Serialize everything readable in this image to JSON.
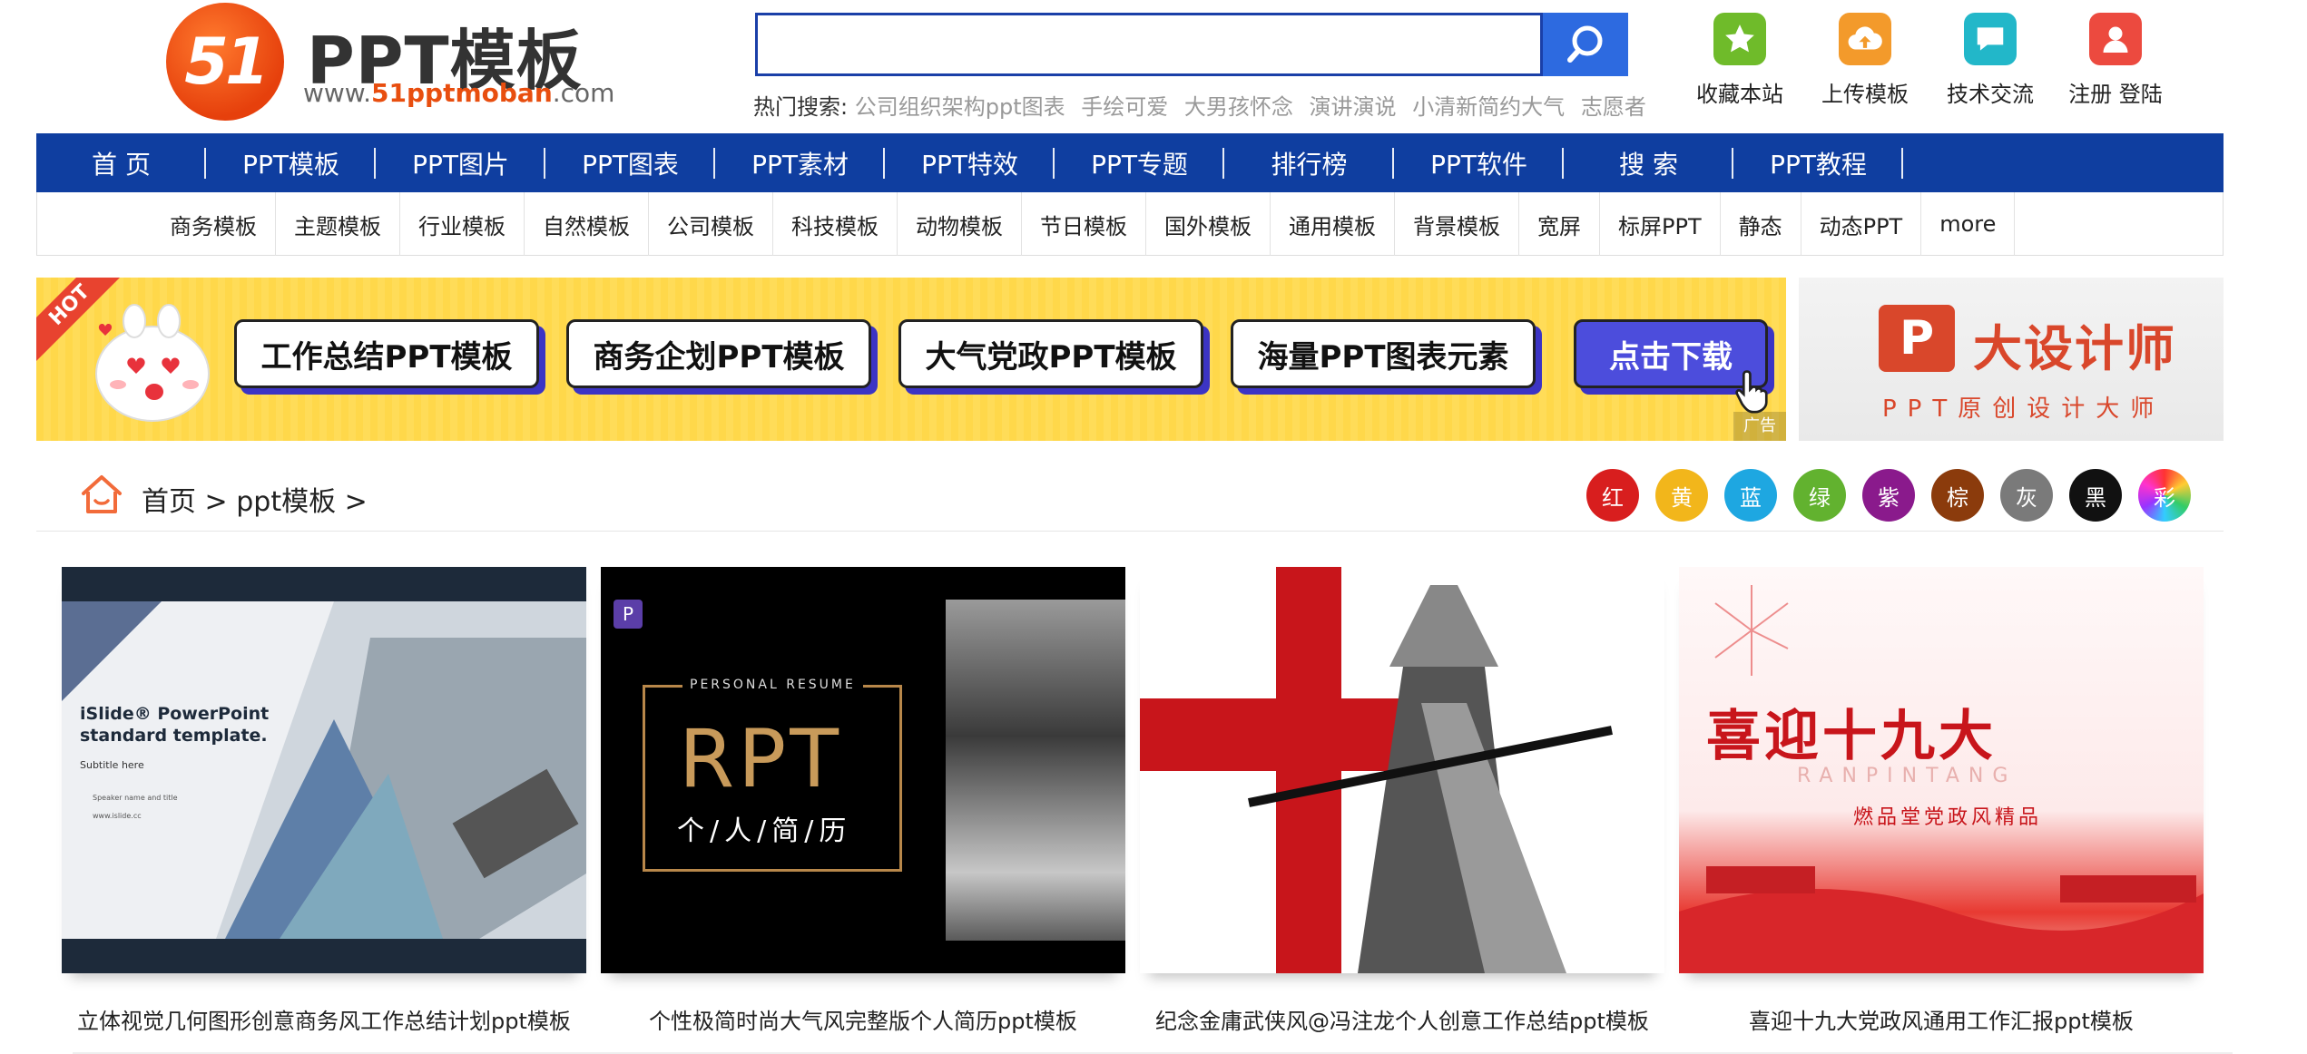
{
  "logo": {
    "badge": "51",
    "title": "PPT模板",
    "url_prefix": "www.",
    "url_brand": "51pptmoban",
    "url_suffix": ".com"
  },
  "search": {
    "value": "",
    "placeholder": ""
  },
  "hot_search": {
    "label": "热门搜索:",
    "keywords": [
      "公司组织架构ppt图表",
      "手绘可爱",
      "大男孩怀念",
      "演讲演说",
      "小清新简约大气",
      "志愿者"
    ]
  },
  "actions": [
    {
      "label": "收藏本站",
      "icon": "star-icon",
      "color": "#6fbb2a"
    },
    {
      "label": "上传模板",
      "icon": "upload-cloud-icon",
      "color": "#f39a2b"
    },
    {
      "label": "技术交流",
      "icon": "chat-icon",
      "color": "#22b7c9"
    },
    {
      "label": "注册 登陆",
      "icon": "user-icon",
      "color": "#ec4a3f"
    }
  ],
  "main_nav": [
    "首 页",
    "PPT模板",
    "PPT图片",
    "PPT图表",
    "PPT素材",
    "PPT特效",
    "PPT专题",
    "排行榜",
    "PPT软件",
    "搜 索",
    "PPT教程"
  ],
  "sub_nav": [
    "商务模板",
    "主题模板",
    "行业模板",
    "自然模板",
    "公司模板",
    "科技模板",
    "动物模板",
    "节日模板",
    "国外模板",
    "通用模板",
    "背景模板",
    "宽屏",
    "标屏PPT",
    "静态",
    "动态PPT",
    "more"
  ],
  "banner": {
    "hot": "HOT",
    "pills": [
      "工作总结PPT模板",
      "商务企划PPT模板",
      "大气党政PPT模板",
      "海量PPT图表元素"
    ],
    "cta": "点击下载",
    "ad_tag": "广告"
  },
  "banner2": {
    "logo": "P",
    "title": "大设计师",
    "subtitle": "PPT原创设计大师"
  },
  "breadcrumb": {
    "home": "首页",
    "sep1": ">",
    "section": "ppt模板",
    "sep2": ">"
  },
  "color_filters": [
    {
      "label": "红",
      "color": "#d81e1e"
    },
    {
      "label": "黄",
      "color": "#f2b61b"
    },
    {
      "label": "蓝",
      "color": "#1ea7e1"
    },
    {
      "label": "绿",
      "color": "#62b22f"
    },
    {
      "label": "紫",
      "color": "#8a1a8c"
    },
    {
      "label": "棕",
      "color": "#8b3b0c"
    },
    {
      "label": "灰",
      "color": "#7a7a7a"
    },
    {
      "label": "黑",
      "color": "#111111"
    },
    {
      "label": "彩",
      "color": "#e34d8b"
    }
  ],
  "cards": [
    {
      "caption": "立体视觉几何图形创意商务风工作总结计划ppt模板",
      "thumb_title": "iSlide® PowerPoint standard template.",
      "thumb_subtitle": "Subtitle here",
      "thumb_line1": "Speaker name and title",
      "thumb_line2": "www.islide.cc"
    },
    {
      "caption": "个性极简时尚大气风完整版个人简历ppt模板",
      "thumb_kicker": "PERSONAL RESUME",
      "thumb_title": "RPT",
      "thumb_subtitle": "个/人/简/历"
    },
    {
      "caption": "纪念金庸武侠风@冯注龙个人创意工作总结ppt模板"
    },
    {
      "caption": "喜迎十九大党政风通用工作汇报ppt模板",
      "thumb_title": "喜迎十九大",
      "thumb_kicker": "RANPINTANG",
      "thumb_subtitle": "燃品堂党政风精品"
    }
  ]
}
